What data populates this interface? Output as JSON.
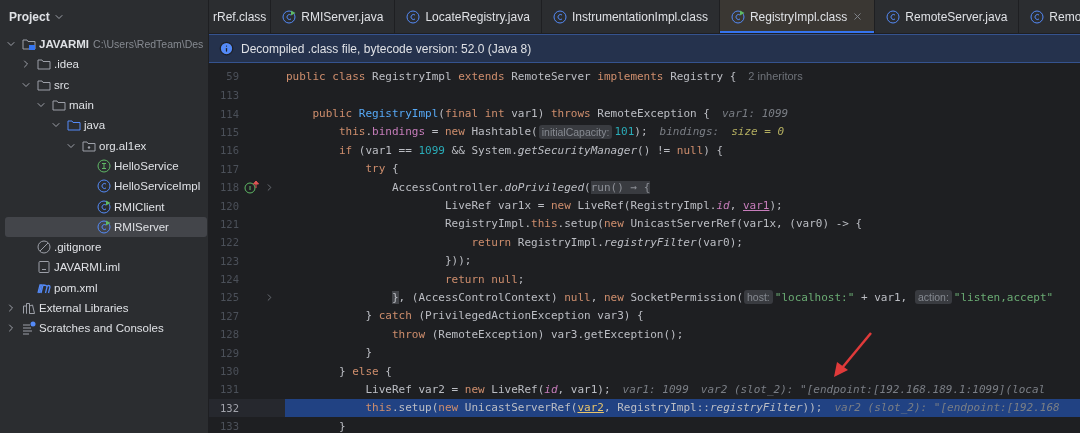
{
  "sidebar": {
    "title": "Project",
    "tree": [
      {
        "label": "JAVARMI",
        "path": "C:\\Users\\RedTeam\\Des",
        "kind": "module",
        "expanded": true,
        "selected": false,
        "children": [
          {
            "label": ".idea",
            "kind": "folder",
            "expanded": false,
            "selected": false
          },
          {
            "label": "src",
            "kind": "folder",
            "expanded": true,
            "selected": false,
            "children": [
              {
                "label": "main",
                "kind": "folder",
                "expanded": true,
                "selected": false,
                "children": [
                  {
                    "label": "java",
                    "kind": "sources",
                    "expanded": true,
                    "selected": false,
                    "children": [
                      {
                        "label": "org.al1ex",
                        "kind": "package",
                        "expanded": true,
                        "selected": false,
                        "children": [
                          {
                            "label": "HelloService",
                            "kind": "interface",
                            "selected": false
                          },
                          {
                            "label": "HelloServiceImpl",
                            "kind": "class",
                            "selected": false
                          },
                          {
                            "label": "RMIClient",
                            "kind": "runnable",
                            "selected": false
                          },
                          {
                            "label": "RMIServer",
                            "kind": "runnable",
                            "selected": true
                          }
                        ]
                      }
                    ]
                  }
                ]
              }
            ]
          },
          {
            "label": ".gitignore",
            "kind": "ignore",
            "selected": false
          },
          {
            "label": "JAVARMI.iml",
            "kind": "iml",
            "selected": false
          },
          {
            "label": "pom.xml",
            "kind": "maven",
            "selected": false
          }
        ]
      },
      {
        "label": "External Libraries",
        "kind": "libraries",
        "expanded": false,
        "selected": false
      },
      {
        "label": "Scratches and Consoles",
        "kind": "scratches",
        "expanded": false,
        "selected": false
      }
    ]
  },
  "tabs": [
    {
      "label": "rRef.class",
      "kind": "plain",
      "selected": false
    },
    {
      "label": "RMIServer.java",
      "kind": "runnable",
      "selected": false
    },
    {
      "label": "LocateRegistry.java",
      "kind": "class",
      "selected": false
    },
    {
      "label": "InstrumentationImpl.class",
      "kind": "class",
      "selected": false
    },
    {
      "label": "RegistryImpl.class",
      "kind": "runnable",
      "selected": true
    },
    {
      "label": "RemoteServer.java",
      "kind": "class",
      "selected": false
    },
    {
      "label": "Remo",
      "kind": "class",
      "selected": false
    }
  ],
  "banner": {
    "text": "Decompiled .class file, bytecode version: 52.0 (Java 8)"
  },
  "editor": {
    "lines": [
      {
        "number": "59",
        "selected": false,
        "tokens": [
          {
            "kind": "kw",
            "text": "public class "
          },
          {
            "kind": "plain",
            "text": "RegistryImpl "
          },
          {
            "kind": "kw",
            "text": "extends "
          },
          {
            "kind": "plain",
            "text": "RemoteServer "
          },
          {
            "kind": "kw",
            "text": "implements "
          },
          {
            "kind": "plain",
            "text": "Registry {"
          },
          {
            "kind": "note",
            "text": "2 inheritors"
          }
        ]
      },
      {
        "number": "113",
        "selected": false
      },
      {
        "number": "114",
        "selected": false,
        "tokens": [
          {
            "kind": "kw",
            "text": "    public "
          },
          {
            "kind": "decl",
            "text": "RegistryImpl"
          },
          {
            "kind": "plain",
            "text": "("
          },
          {
            "kind": "kw",
            "text": "final int "
          },
          {
            "kind": "plain",
            "text": "var1) "
          },
          {
            "kind": "kw",
            "text": "throws "
          },
          {
            "kind": "plain",
            "text": "RemoteException {"
          },
          {
            "kind": "inlay",
            "text": "var1: 1099"
          }
        ]
      },
      {
        "number": "115",
        "selected": false,
        "tokens": [
          {
            "kind": "kw",
            "text": "        this"
          },
          {
            "kind": "plain",
            "text": "."
          },
          {
            "kind": "field",
            "text": "bindings"
          },
          {
            "kind": "plain",
            "text": " = "
          },
          {
            "kind": "kw",
            "text": "new "
          },
          {
            "kind": "plain",
            "text": "Hashtable("
          },
          {
            "kind": "param",
            "text": "initialCapacity:"
          },
          {
            "kind": "num",
            "text": "101"
          },
          {
            "kind": "plain",
            "text": ");"
          },
          {
            "kind": "inlay",
            "text": "bindings:"
          },
          {
            "kind": "inlayval",
            "text": "size = 0"
          }
        ]
      },
      {
        "number": "116",
        "selected": false,
        "tokens": [
          {
            "kind": "kw",
            "text": "        if "
          },
          {
            "kind": "plain",
            "text": "(var1 == "
          },
          {
            "kind": "num",
            "text": "1099"
          },
          {
            "kind": "plain",
            "text": " && System."
          },
          {
            "kind": "static",
            "text": "getSecurityManager"
          },
          {
            "kind": "plain",
            "text": "() != "
          },
          {
            "kind": "kw",
            "text": "null"
          },
          {
            "kind": "plain",
            "text": ") {"
          }
        ]
      },
      {
        "number": "117",
        "selected": false,
        "tokens": [
          {
            "kind": "kw",
            "text": "            try "
          },
          {
            "kind": "plain",
            "text": "{"
          }
        ]
      },
      {
        "number": "118",
        "selected": false,
        "marker": true,
        "fold": true,
        "tokens": [
          {
            "kind": "plain",
            "text": "                AccessController."
          },
          {
            "kind": "static",
            "text": "doPrivileged"
          },
          {
            "kind": "plain",
            "text": "("
          },
          {
            "kind": "folded",
            "text": "run() → {"
          }
        ]
      },
      {
        "number": "120",
        "selected": false,
        "tokens": [
          {
            "kind": "plain",
            "text": "                        LiveRef var1x = "
          },
          {
            "kind": "kw",
            "text": "new "
          },
          {
            "kind": "plain",
            "text": "LiveRef(RegistryImpl."
          },
          {
            "kind": "staticfield",
            "text": "id"
          },
          {
            "kind": "plain",
            "text": ", "
          },
          {
            "kind": "reassigned",
            "text": "var1"
          },
          {
            "kind": "plain",
            "text": ");"
          }
        ]
      },
      {
        "number": "121",
        "selected": false,
        "tokens": [
          {
            "kind": "plain",
            "text": "                        RegistryImpl."
          },
          {
            "kind": "kw",
            "text": "this"
          },
          {
            "kind": "plain",
            "text": ".setup("
          },
          {
            "kind": "kw",
            "text": "new "
          },
          {
            "kind": "plain",
            "text": "UnicastServerRef(var1x, (var0) -> {"
          }
        ]
      },
      {
        "number": "122",
        "selected": false,
        "tokens": [
          {
            "kind": "kw",
            "text": "                            return "
          },
          {
            "kind": "plain",
            "text": "RegistryImpl."
          },
          {
            "kind": "static",
            "text": "registryFilter"
          },
          {
            "kind": "plain",
            "text": "(var0);"
          }
        ]
      },
      {
        "number": "123",
        "selected": false,
        "tokens": [
          {
            "kind": "plain",
            "text": "                        }));"
          }
        ]
      },
      {
        "number": "124",
        "selected": false,
        "tokens": [
          {
            "kind": "kw",
            "text": "                        return null"
          },
          {
            "kind": "plain",
            "text": ";"
          }
        ]
      },
      {
        "number": "125",
        "selected": false,
        "fold": true,
        "tokens": [
          {
            "kind": "brace",
            "text": "                }"
          },
          {
            "kind": "plain",
            "text": ", (AccessControlContext) "
          },
          {
            "kind": "kw",
            "text": "null"
          },
          {
            "kind": "plain",
            "text": ", "
          },
          {
            "kind": "kw",
            "text": "new "
          },
          {
            "kind": "plain",
            "text": "SocketPermission("
          },
          {
            "kind": "param",
            "text": "host:"
          },
          {
            "kind": "str",
            "text": "\"localhost:\""
          },
          {
            "kind": "plain",
            "text": " + var1, "
          },
          {
            "kind": "param",
            "text": "action:"
          },
          {
            "kind": "str",
            "text": "\"listen,accept\""
          }
        ]
      },
      {
        "number": "127",
        "selected": false,
        "tokens": [
          {
            "kind": "plain",
            "text": "            } "
          },
          {
            "kind": "kw",
            "text": "catch "
          },
          {
            "kind": "plain",
            "text": "(PrivilegedActionException var3) {"
          }
        ]
      },
      {
        "number": "128",
        "selected": false,
        "tokens": [
          {
            "kind": "kw",
            "text": "                throw "
          },
          {
            "kind": "plain",
            "text": "(RemoteException) var3.getException();"
          }
        ]
      },
      {
        "number": "129",
        "selected": false,
        "tokens": [
          {
            "kind": "plain",
            "text": "            }"
          }
        ]
      },
      {
        "number": "130",
        "selected": false,
        "tokens": [
          {
            "kind": "plain",
            "text": "        } "
          },
          {
            "kind": "kw",
            "text": "else "
          },
          {
            "kind": "plain",
            "text": "{"
          }
        ]
      },
      {
        "number": "131",
        "selected": false,
        "tokens": [
          {
            "kind": "plain",
            "text": "            LiveRef var2 = "
          },
          {
            "kind": "kw",
            "text": "new "
          },
          {
            "kind": "plain",
            "text": "LiveRef("
          },
          {
            "kind": "staticfield",
            "text": "id"
          },
          {
            "kind": "plain",
            "text": ", var1);"
          },
          {
            "kind": "inlay",
            "text": "var1: 1099"
          },
          {
            "kind": "inlay",
            "text": "var2 (slot_2): \"[endpoint:[192.168.189.1:1099](local"
          }
        ]
      },
      {
        "number": "132",
        "selected": true,
        "tokens": [
          {
            "kind": "kw",
            "text": "            this"
          },
          {
            "kind": "plain",
            "text": ".setup("
          },
          {
            "kind": "kw",
            "text": "new "
          },
          {
            "kind": "plain",
            "text": "UnicastServerRef("
          },
          {
            "kind": "usage",
            "text": "var2"
          },
          {
            "kind": "plain",
            "text": ", RegistryImpl::"
          },
          {
            "kind": "static",
            "text": "registryFilter"
          },
          {
            "kind": "plain",
            "text": "));"
          },
          {
            "kind": "inlay",
            "text": "var2 (slot_2): \"[endpoint:[192.168"
          }
        ]
      },
      {
        "number": "133",
        "selected": false,
        "tokens": [
          {
            "kind": "plain",
            "text": "        }"
          }
        ]
      }
    ]
  }
}
